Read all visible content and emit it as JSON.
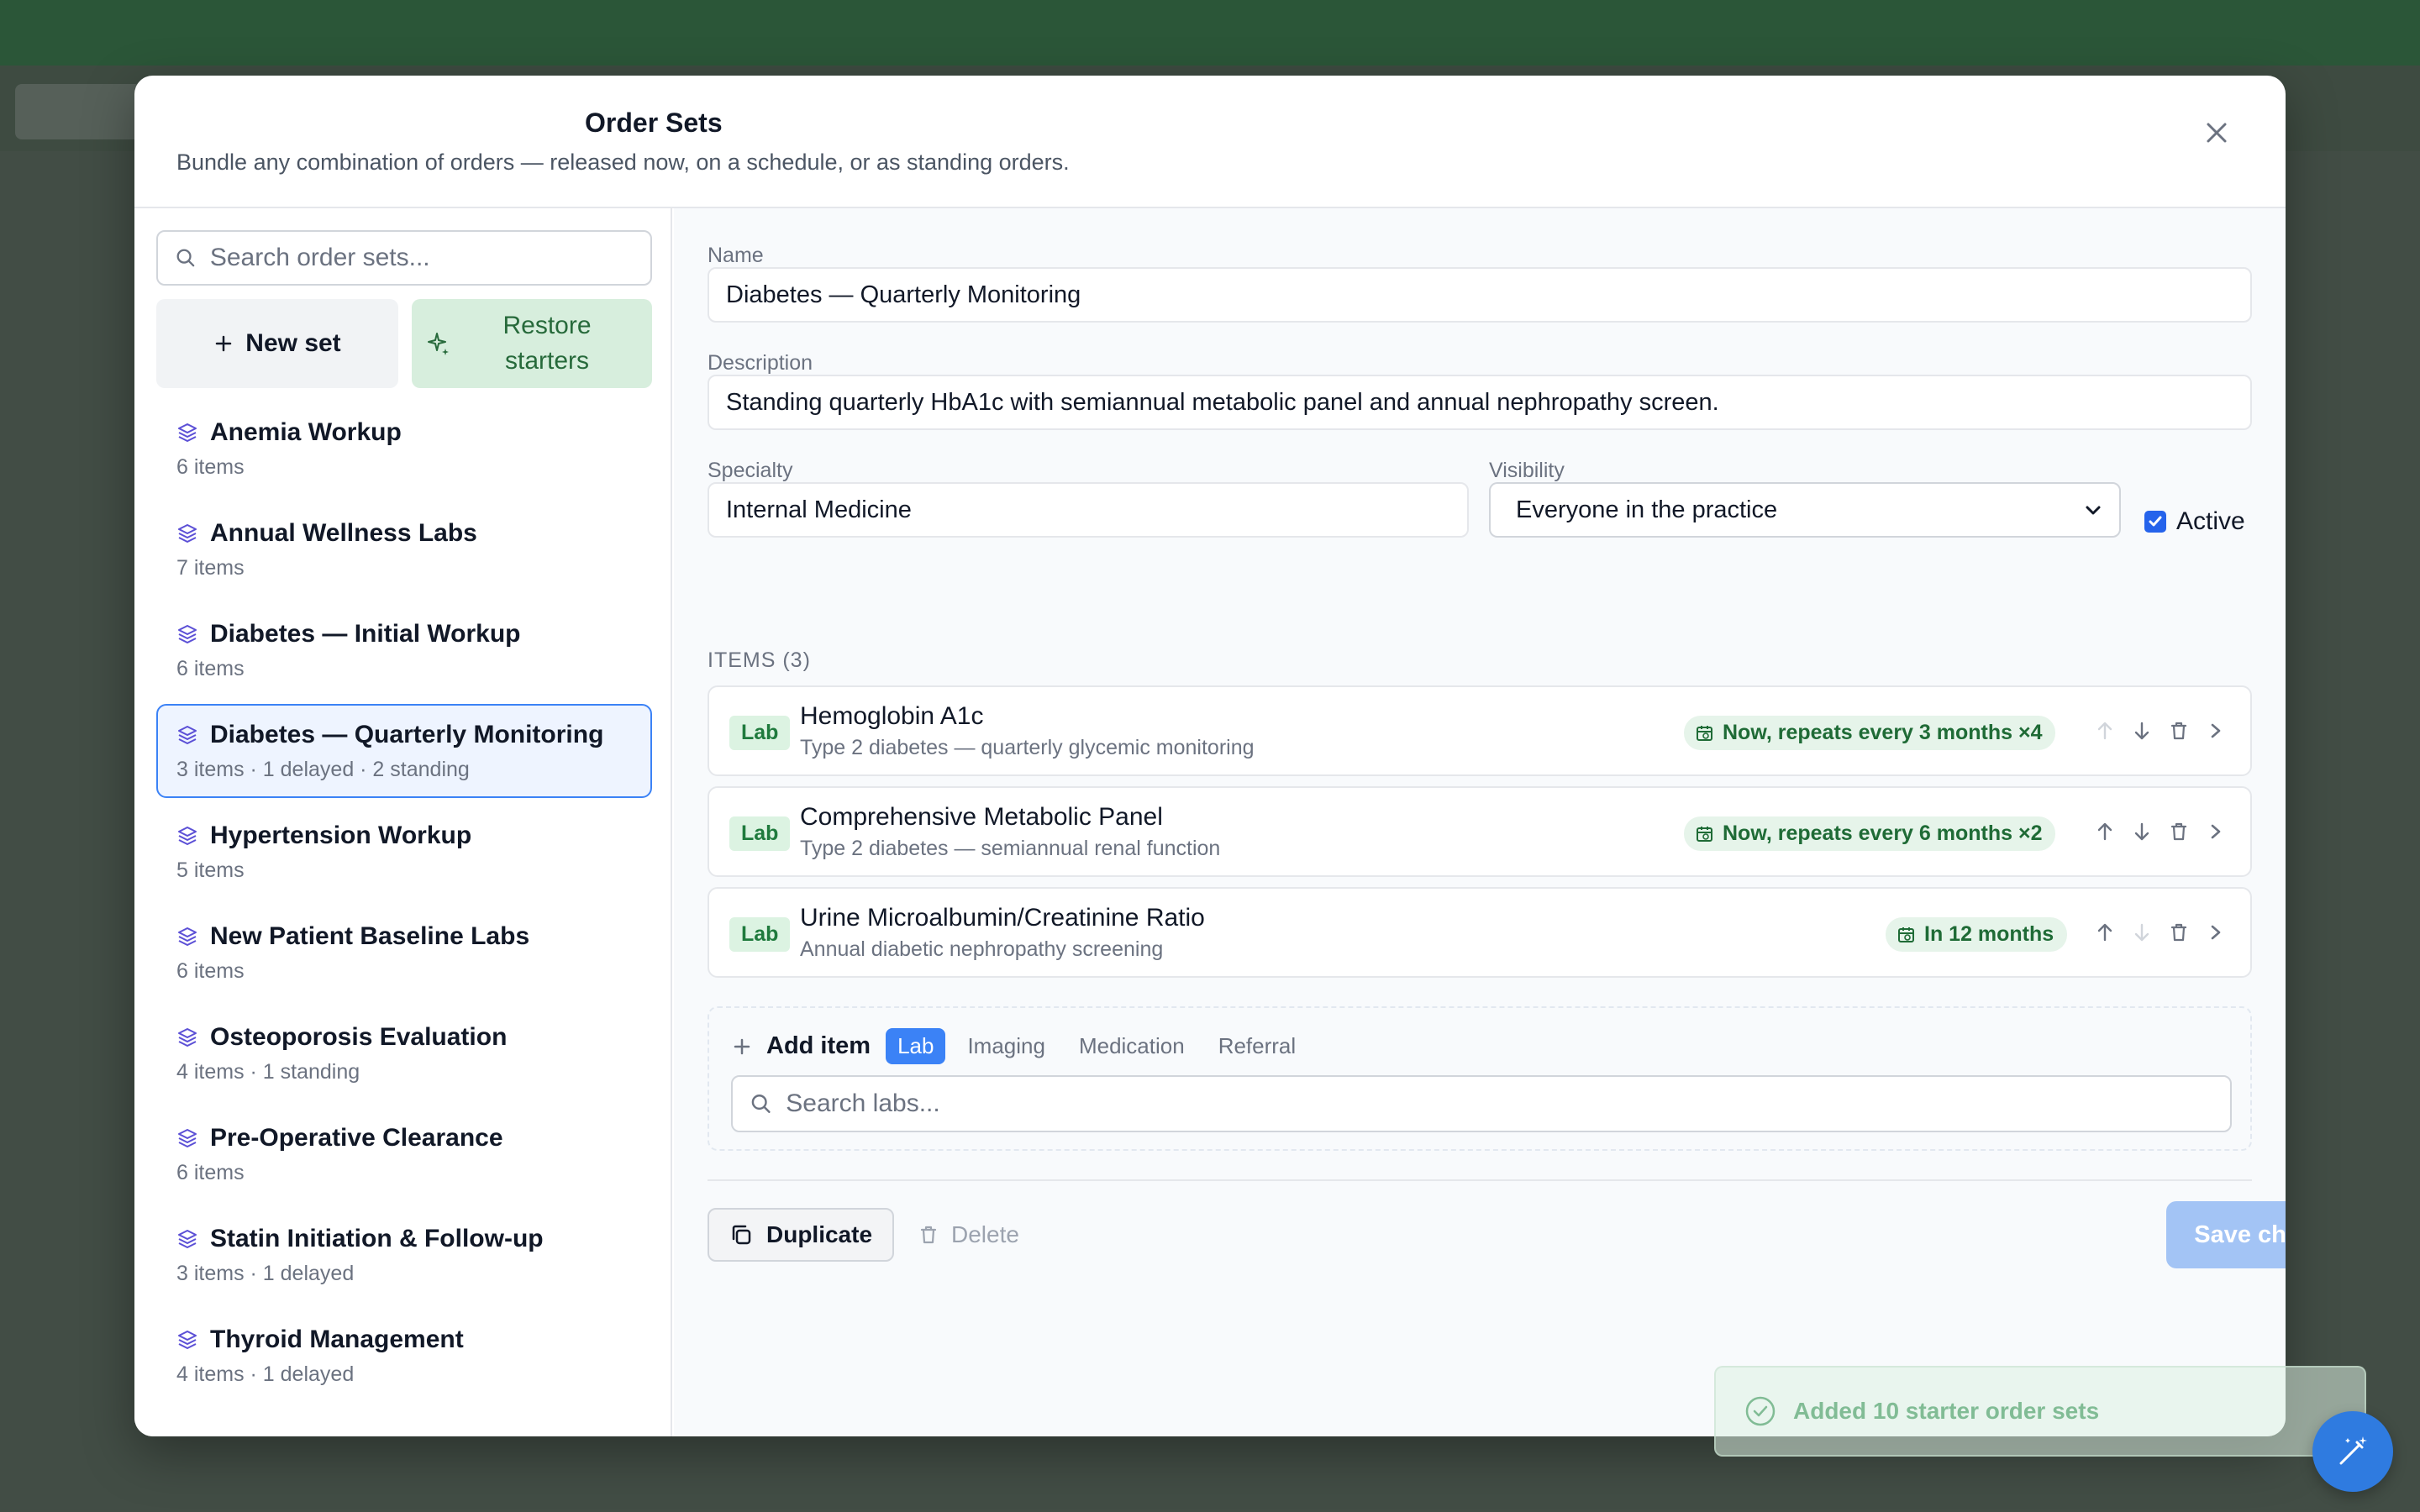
{
  "modal": {
    "title": "Order Sets",
    "subtitle": "Bundle any combination of orders — released now, on a schedule, or as standing orders."
  },
  "sidebar": {
    "search_placeholder": "Search order sets...",
    "new_set_label": "New set",
    "restore_label": "Restore starters",
    "sets": [
      {
        "name": "Anemia Workup",
        "meta": "6 items"
      },
      {
        "name": "Annual Wellness Labs",
        "meta": "7 items"
      },
      {
        "name": "Diabetes — Initial Workup",
        "meta": "6 items"
      },
      {
        "name": "Diabetes — Quarterly Monitoring",
        "meta": "3 items · 1 delayed · 2 standing"
      },
      {
        "name": "Hypertension Workup",
        "meta": "5 items"
      },
      {
        "name": "New Patient Baseline Labs",
        "meta": "6 items"
      },
      {
        "name": "Osteoporosis Evaluation",
        "meta": "4 items · 1 standing"
      },
      {
        "name": "Pre-Operative Clearance",
        "meta": "6 items"
      },
      {
        "name": "Statin Initiation & Follow-up",
        "meta": "3 items · 1 delayed"
      },
      {
        "name": "Thyroid Management",
        "meta": "4 items · 1 delayed"
      }
    ],
    "selected_index": 3
  },
  "form": {
    "name_label": "Name",
    "name_value": "Diabetes — Quarterly Monitoring",
    "description_label": "Description",
    "description_value": "Standing quarterly HbA1c with semiannual metabolic panel and annual nephropathy screen.",
    "specialty_label": "Specialty",
    "specialty_value": "Internal Medicine",
    "visibility_label": "Visibility",
    "visibility_value": "Everyone in the practice",
    "active_label": "Active",
    "active_checked": true
  },
  "items": {
    "header": "ITEMS (3)",
    "rows": [
      {
        "type": "Lab",
        "name": "Hemoglobin A1c",
        "desc": "Type 2 diabetes — quarterly glycemic monitoring",
        "schedule": "Now, repeats every 3 months ×4"
      },
      {
        "type": "Lab",
        "name": "Comprehensive Metabolic Panel",
        "desc": "Type 2 diabetes — semiannual renal function",
        "schedule": "Now, repeats every 6 months ×2"
      },
      {
        "type": "Lab",
        "name": "Urine Microalbumin/Creatinine Ratio",
        "desc": "Annual diabetic nephropathy screening",
        "schedule": "In 12 months"
      }
    ]
  },
  "add_item": {
    "label": "Add item",
    "tabs": [
      "Lab",
      "Imaging",
      "Medication",
      "Referral"
    ],
    "active_tab": "Lab",
    "search_placeholder": "Search labs..."
  },
  "footer": {
    "duplicate_label": "Duplicate",
    "delete_label": "Delete",
    "save_label": "Save changes"
  },
  "toast": {
    "message": "Added 10 starter order sets"
  },
  "colors": {
    "accent": "#3b82f6",
    "success": "#1f7a3d",
    "icon_violet": "#5b4fd6"
  }
}
